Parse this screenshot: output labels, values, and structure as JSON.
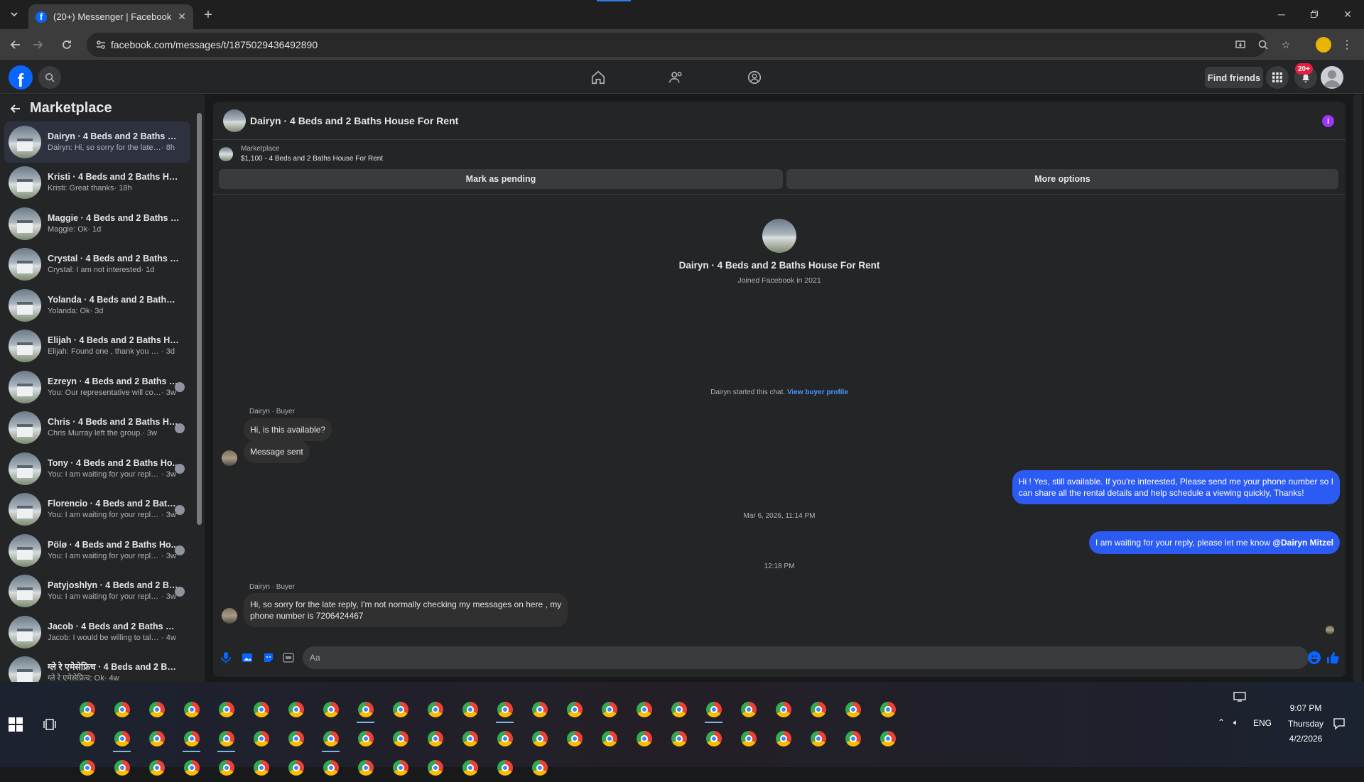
{
  "browser": {
    "tab_title": "(20+) Messenger | Facebook",
    "url": "facebook.com/messages/t/1875029436492890"
  },
  "fb_header": {
    "logo": "f",
    "find_friends": "Find friends",
    "notification_count": "20+"
  },
  "sidebar": {
    "title": "Marketplace",
    "conversations": [
      {
        "name": "Dairyn · 4 Beds and 2 Baths Ho...",
        "snippet": "Dairyn: Hi, so sorry for the late repl...",
        "time": "· 8h",
        "active": true
      },
      {
        "name": "Kristi · 4 Beds and 2 Baths Hous...",
        "snippet": "Kristi: Great thanks",
        "time": "· 18h"
      },
      {
        "name": "Maggie · 4 Beds and 2 Baths Ho...",
        "snippet": "Maggie: Ok",
        "time": "· 1d"
      },
      {
        "name": "Crystal · 4 Beds and 2 Baths Ho...",
        "snippet": "Crystal: I am not interested",
        "time": "· 1d"
      },
      {
        "name": "Yolanda · 4 Beds and 2 Baths H...",
        "snippet": "Yolanda: Ok",
        "time": "· 3d"
      },
      {
        "name": "Elijah · 4 Beds and 2 Baths Hous...",
        "snippet": "Elijah: Found one , thank you have...",
        "time": "· 3d"
      },
      {
        "name": "Ezreyn · 4 Beds and 2 Baths H...",
        "snippet": "You: Our representative will con...",
        "time": "· 3w"
      },
      {
        "name": "Chris · 4 Beds and 2 Baths Hous...",
        "snippet": "Chris Murray left the group.",
        "time": "· 3w"
      },
      {
        "name": "Tony · 4 Beds and 2 Baths Ho...",
        "snippet": "You: I am waiting for your reply,...",
        "time": "· 3w"
      },
      {
        "name": "Florencio · 4 Beds and 2 Bath...",
        "snippet": "You: I am waiting for your reply,...",
        "time": "· 3w"
      },
      {
        "name": "Pölø · 4 Beds and 2 Baths Ho...",
        "snippet": "You: I am waiting for your reply,...",
        "time": "· 3w"
      },
      {
        "name": "Patyjoshlyn · 4 Beds and 2 Ba...",
        "snippet": "You: I am waiting for your reply,...",
        "time": "· 3w"
      },
      {
        "name": "Jacob · 4 Beds and 2 Baths Hou...",
        "snippet": "Jacob: I would be willing to talk if ...",
        "time": "· 4w"
      },
      {
        "name": "ग्ले रे एमेसेफ्रिच · 4 Beds and 2 Bat...",
        "snippet": "ग्ले रे एमेसेफ्रिच: Ok",
        "time": "· 4w"
      }
    ]
  },
  "chat": {
    "header_name": "Dairyn · 4 Beds and 2 Baths House For Rent",
    "listing_source": "Marketplace",
    "listing_title": "$1,100 - 4 Beds and 2 Baths House For Rent",
    "mark_pending": "Mark as pending",
    "more_options": "More options",
    "profile_name": "Dairyn · 4 Beds and 2 Baths House For Rent",
    "profile_joined": "Joined Facebook in 2021",
    "started_note": "Dairyn started this chat.",
    "view_buyer_profile": "View buyer profile",
    "sender_label": "Dairyn · Buyer",
    "msg1": "Hi, is this available?",
    "msg2": "Message sent",
    "out1_line1": "Hi ! Yes, still available. If you're interested, Please send me your phone number so I",
    "out1_line2": "can share all the rental details and help schedule a viewing quickly, Thanks!",
    "timestamp1": "Mar 6, 2026, 11:14 PM",
    "out2_text": "I am waiting for your reply, please let me know",
    "out2_mention": "@Dairyn Mitzel",
    "timestamp2": "12:18 PM",
    "sender_label2": "Dairyn · Buyer",
    "msg3_line1": "Hi, so sorry for the late reply, I'm not normally checking my messages on here , my",
    "msg3_line2": "phone number is 7206424467",
    "input_placeholder": "Aa"
  },
  "taskbar": {
    "time": "9:07 PM",
    "day": "Thursday",
    "date": "4/2/2026",
    "lang": "ENG"
  }
}
